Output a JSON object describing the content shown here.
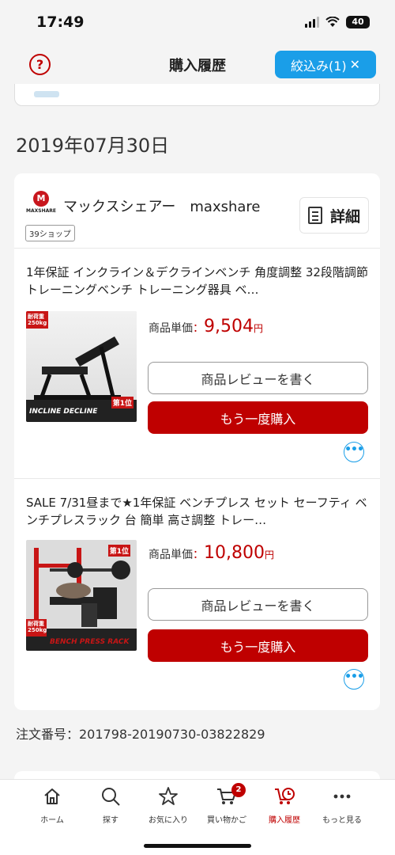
{
  "status": {
    "time": "17:49",
    "battery": "40"
  },
  "header": {
    "title": "購入履歴",
    "filter_label": "絞込み(1)",
    "help_label": "?",
    "filter_clear": "✕"
  },
  "date_heading": "2019年07月30日",
  "shop": {
    "logo_mark": "M",
    "logo_text": "MAXSHARE",
    "name": "マックスシェアー　maxshare",
    "tag": "39ショップ",
    "detail_label": "詳細"
  },
  "items": [
    {
      "title": "1年保証 インクライン＆デクラインベンチ 角度調整 32段階調節 トレーニングベンチ トレーニング器具 ベ…",
      "price_label": "商品単価",
      "price_colon": "：",
      "price": "9,504",
      "price_unit": "円",
      "review_label": "商品レビューを書く",
      "buy_label": "もう一度購入",
      "more_label": "•••",
      "img_badge": "耐荷重 250kg",
      "img_text": "INCLINE DECLINE",
      "img_rank": "第1位"
    },
    {
      "title": "SALE 7/31昼まで★1年保証 ベンチプレス セット セーフティ ベンチプレスラック 台 簡単 高さ調整 トレー…",
      "price_label": "商品単価",
      "price_colon": "：",
      "price": "10,800",
      "price_unit": "円",
      "review_label": "商品レビューを書く",
      "buy_label": "もう一度購入",
      "more_label": "•••",
      "img_badge": "耐荷重 250kg",
      "img_text": "BENCH PRESS RACK",
      "img_rank": "第1位"
    }
  ],
  "order_number": "注文番号：201798-20190730-03822829",
  "tabbar": {
    "cart_count": "2",
    "tabs": [
      {
        "label": "ホーム",
        "icon": "home-icon"
      },
      {
        "label": "探す",
        "icon": "search-icon"
      },
      {
        "label": "お気に入り",
        "icon": "star-icon"
      },
      {
        "label": "買い物かご",
        "icon": "cart-icon"
      },
      {
        "label": "購入履歴",
        "icon": "history-icon"
      },
      {
        "label": "もっと見る",
        "icon": "more-icon"
      }
    ]
  },
  "colors": {
    "accent": "#bf0000",
    "link": "#1a9ee8"
  }
}
